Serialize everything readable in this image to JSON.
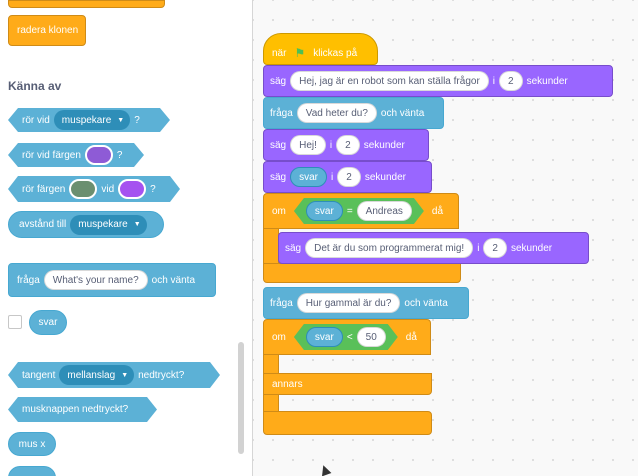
{
  "palette": {
    "delete_clone": "radera klonen",
    "category_label": "Känna av",
    "touching": {
      "label": "rör vid",
      "dropdown": "muspekare",
      "q": "?"
    },
    "touching_color": {
      "label": "rör vid färgen",
      "q": "?",
      "color": "#8e5bd6"
    },
    "color_touching": {
      "label": "rör färgen",
      "mid": "vid",
      "q": "?",
      "color1": "#6b8f70",
      "color2": "#a552f0"
    },
    "distance": {
      "label": "avstånd till",
      "dropdown": "muspekare"
    },
    "ask": {
      "label": "fråga",
      "input": "What's your name?",
      "suffix": "och vänta"
    },
    "answer": "svar",
    "key_pressed": {
      "label": "tangent",
      "dropdown": "mellanslag",
      "suffix": "nedtryckt?"
    },
    "mouse_down": "musknappen nedtryckt?",
    "mouse_x": "mus x"
  },
  "script": {
    "hat": {
      "label_pre": "när",
      "label_post": "klickas på"
    },
    "say1": {
      "label": "säg",
      "text": "Hej, jag är en robot som kan ställa frågor",
      "i": "i",
      "secs": "2",
      "unit": "sekunder"
    },
    "ask1": {
      "label": "fråga",
      "text": "Vad heter du?",
      "suffix": "och vänta"
    },
    "say2": {
      "label": "säg",
      "text": "Hej!",
      "i": "i",
      "secs": "2",
      "unit": "sekunder"
    },
    "say3": {
      "label": "säg",
      "answer": "svar",
      "i": "i",
      "secs": "2",
      "unit": "sekunder"
    },
    "if1": {
      "label": "om",
      "answer": "svar",
      "op": "=",
      "value": "Andreas",
      "then": "då"
    },
    "say4": {
      "label": "säg",
      "text": "Det är du som programmerat mig!",
      "i": "i",
      "secs": "2",
      "unit": "sekunder"
    },
    "ask2": {
      "label": "fråga",
      "text": "Hur gammal är du?",
      "suffix": "och vänta"
    },
    "if2": {
      "label": "om",
      "answer": "svar",
      "op": "<",
      "value": "50",
      "then": "då",
      "else": "annars"
    }
  }
}
